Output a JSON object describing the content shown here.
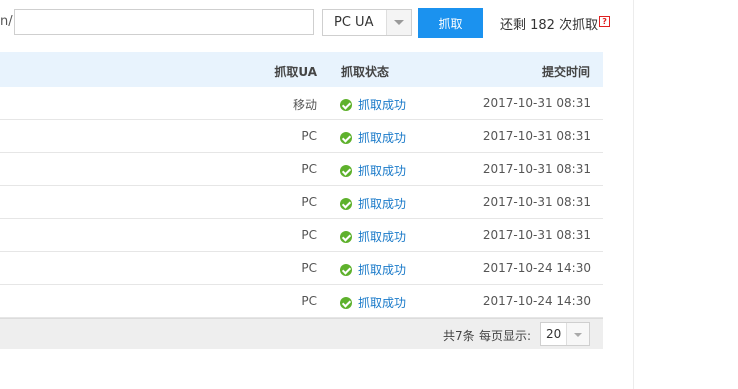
{
  "search": {
    "url_prefix": "n/",
    "url_value": "",
    "ua_selected": "PC UA",
    "fetch_button": "抓取",
    "remaining_text": "还剩 182 次抓取",
    "help_icon_text": "?"
  },
  "table": {
    "headers": {
      "ua": "抓取UA",
      "status": "抓取状态",
      "time": "提交时间"
    },
    "rows": [
      {
        "ua": "移动",
        "status": "抓取成功",
        "time": "2017-10-31 08:31"
      },
      {
        "ua": "PC",
        "status": "抓取成功",
        "time": "2017-10-31 08:31"
      },
      {
        "ua": "PC",
        "status": "抓取成功",
        "time": "2017-10-31 08:31"
      },
      {
        "ua": "PC",
        "status": "抓取成功",
        "time": "2017-10-31 08:31"
      },
      {
        "ua": "PC",
        "status": "抓取成功",
        "time": "2017-10-31 08:31"
      },
      {
        "ua": "PC",
        "status": "抓取成功",
        "time": "2017-10-24 14:30"
      },
      {
        "ua": "PC",
        "status": "抓取成功",
        "time": "2017-10-24 14:30"
      }
    ],
    "footer": {
      "total": "共7条",
      "per_page_label": "每页显示:",
      "per_page_value": "20"
    }
  },
  "colors": {
    "accent": "#1b92ef",
    "success": "#5eb12c",
    "link": "#1a7ac9",
    "header_bg": "#e8f3fd"
  }
}
